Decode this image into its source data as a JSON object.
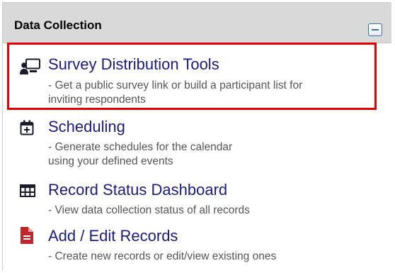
{
  "panel": {
    "title": "Data Collection"
  },
  "items": [
    {
      "label": "Survey Distribution Tools",
      "description": "- Get a public survey link or build a participant list for\n  inviting respondents",
      "icon": "survey-distribution-icon"
    },
    {
      "label": "Scheduling",
      "description": "- Generate schedules for the calendar\n  using your defined events",
      "icon": "calendar-plus-icon"
    },
    {
      "label": "Record Status Dashboard",
      "description": "- View data collection status of all records",
      "icon": "table-grid-icon"
    },
    {
      "label": "Add / Edit Records",
      "description": "- Create new records or edit/view existing ones",
      "icon": "document-icon"
    }
  ],
  "colors": {
    "link": "#1a1a80",
    "highlight": "#e60000",
    "record_icon": "#c0272d",
    "header_bg": "#d9d9d9"
  }
}
